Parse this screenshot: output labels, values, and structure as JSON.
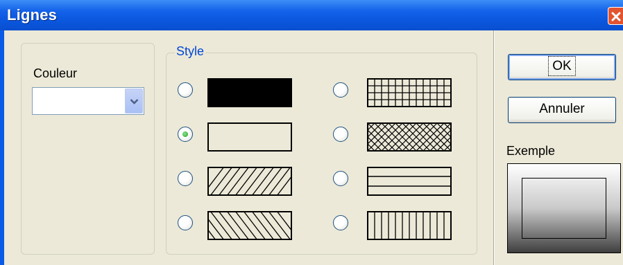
{
  "window": {
    "title": "Lignes",
    "close_icon": "close-icon",
    "title_color": "#0a5ce6",
    "close_color": "#e2542f"
  },
  "color_section": {
    "label": "Couleur",
    "selected_value": "",
    "dropdown_icon": "chevron-down-icon"
  },
  "style_section": {
    "legend": "Style",
    "selected": "outline",
    "options": [
      {
        "id": "solid",
        "pattern": "solid-fill",
        "checked": false
      },
      {
        "id": "outline",
        "pattern": "hollow",
        "checked": true
      },
      {
        "id": "diag-forward",
        "pattern": "diagonal-forward-hatch",
        "checked": false
      },
      {
        "id": "diag-back",
        "pattern": "diagonal-backward-hatch",
        "checked": false
      },
      {
        "id": "grid",
        "pattern": "cross-grid-hatch",
        "checked": false
      },
      {
        "id": "crosshatch",
        "pattern": "diagonal-cross-hatch",
        "checked": false
      },
      {
        "id": "horizontal",
        "pattern": "horizontal-lines",
        "checked": false
      },
      {
        "id": "vertical",
        "pattern": "vertical-lines",
        "checked": false
      }
    ]
  },
  "buttons": {
    "ok": "OK",
    "cancel": "Annuler"
  },
  "preview": {
    "label": "Exemple"
  }
}
